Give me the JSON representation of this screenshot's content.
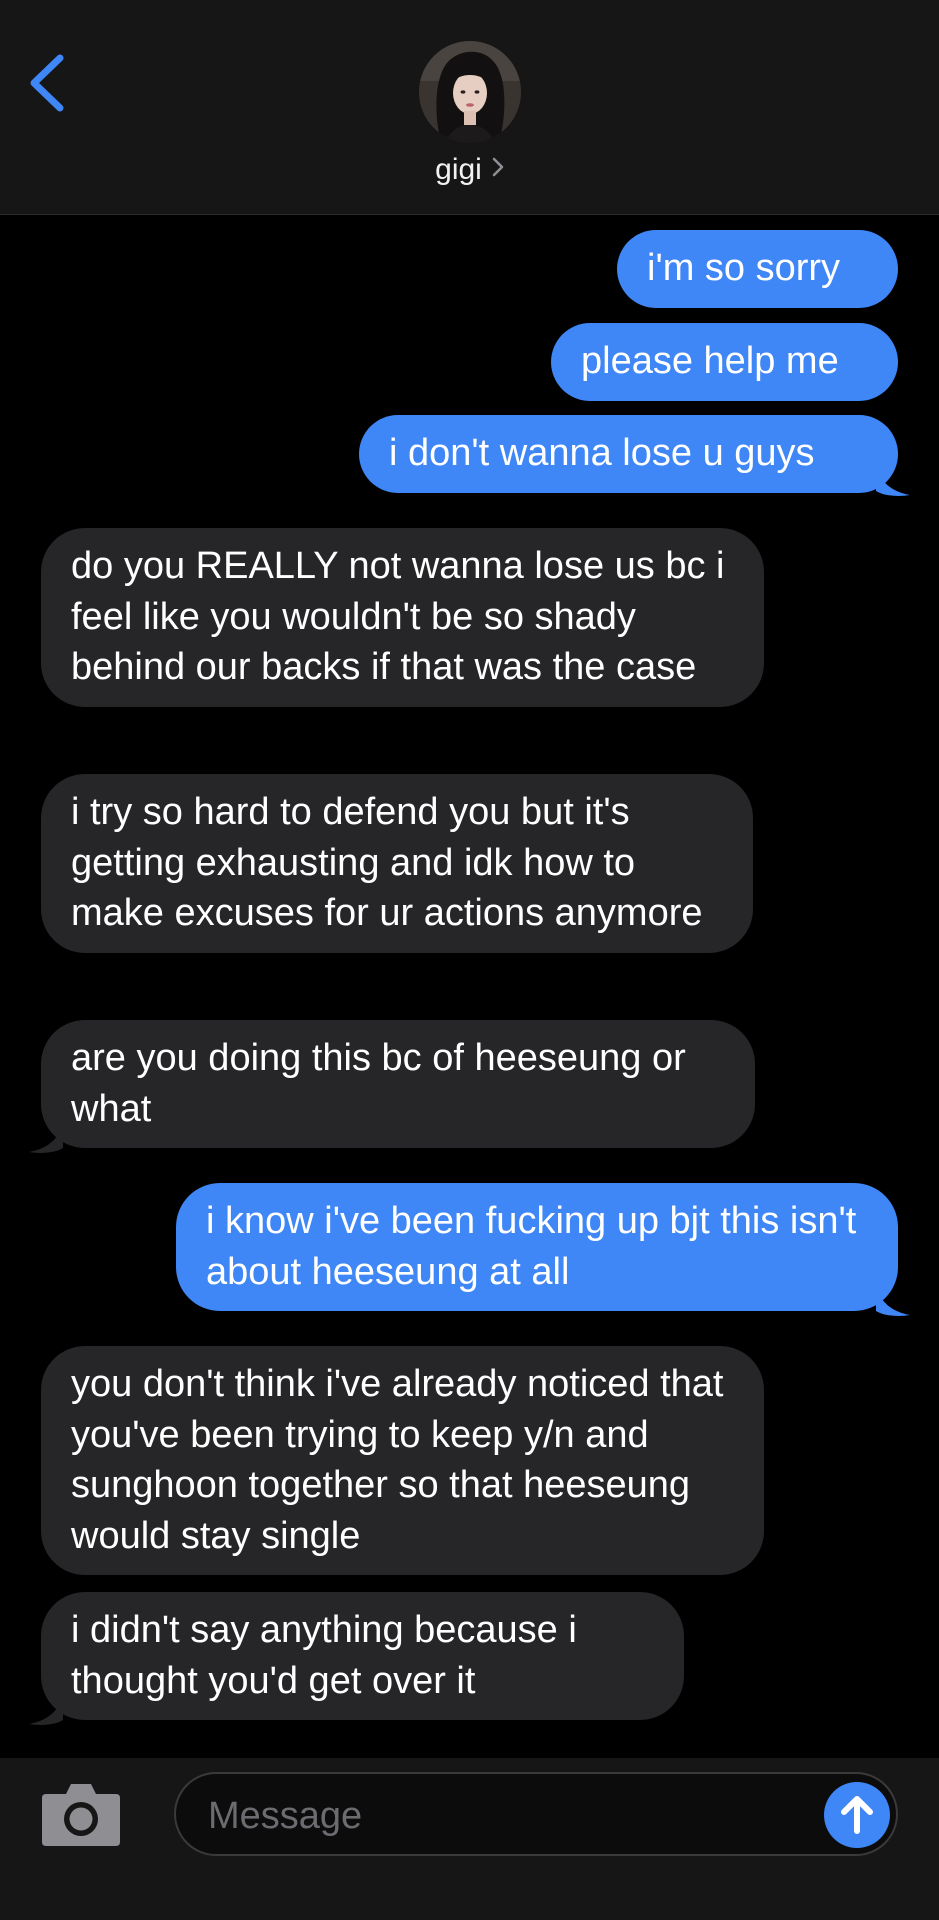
{
  "header": {
    "contact_name": "gigi",
    "back_icon": "chevron-left-icon",
    "accent_color": "#3f86f6"
  },
  "messages": [
    {
      "direction": "sent",
      "text": "i'm so sorry"
    },
    {
      "direction": "sent",
      "text": "please help me"
    },
    {
      "direction": "sent",
      "text": "i don't wanna lose u guys"
    },
    {
      "direction": "received",
      "text": "do you REALLY not wanna lose us bc i feel like you wouldn't be so shady behind our backs if that was the case"
    },
    {
      "direction": "received",
      "text": "i try so hard to defend you but it's getting exhausting and idk how to make excuses for ur actions anymore"
    },
    {
      "direction": "received",
      "text": "are you doing this bc of heeseung or what"
    },
    {
      "direction": "sent",
      "text": "i know i've been fucking up bjt this isn't about heeseung at all"
    },
    {
      "direction": "received",
      "text": "you don't think i've already noticed that you've been trying to keep y/n and sunghoon together so that heeseung would stay single"
    },
    {
      "direction": "received",
      "text": "i didn't say anything because i thought you'd get over it"
    }
  ],
  "composer": {
    "placeholder": "Message",
    "camera_icon": "camera-icon",
    "send_icon": "arrow-up-icon"
  },
  "colors": {
    "sent_bubble": "#3f86f6",
    "received_bubble": "#262628",
    "background": "#000000",
    "bar_background": "#161616"
  }
}
